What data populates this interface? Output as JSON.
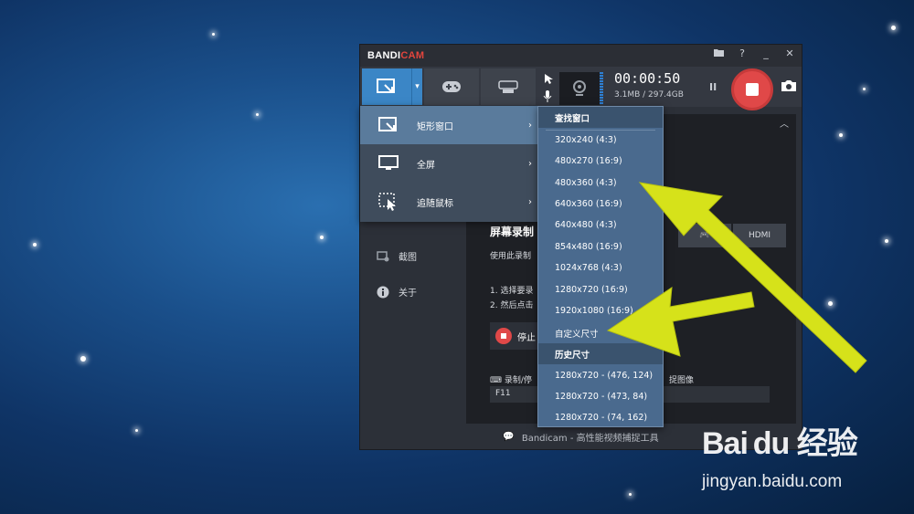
{
  "app": {
    "logo_main": "BANDI",
    "logo_accent": "CAM",
    "title_icons": [
      "folder-icon",
      "help-icon",
      "minimize-icon",
      "close-icon"
    ],
    "help_label": "?",
    "minimize_label": "_",
    "close_label": "✕"
  },
  "recording": {
    "timer": "00:00:50",
    "size": "3.1MB / 297.4GB",
    "pause_label": "II"
  },
  "mode_menu": {
    "items": [
      {
        "label": "矩形窗口",
        "icon": "rectangle-icon",
        "arrow": "›"
      },
      {
        "label": "全屏",
        "icon": "monitor-icon",
        "arrow": "›"
      },
      {
        "label": "追随鼠标",
        "icon": "cursor-select-icon",
        "arrow": "›"
      }
    ]
  },
  "size_menu": {
    "header1": "查找窗口",
    "sizes": [
      "320x240 (4:3)",
      "480x270 (16:9)",
      "480x360 (4:3)",
      "640x360 (16:9)",
      "640x480 (4:3)",
      "854x480 (16:9)",
      "1024x768 (4:3)",
      "1280x720 (16:9)",
      "1920x1080 (16:9)"
    ],
    "custom": "自定义尺寸",
    "header2": "历史尺寸",
    "history": [
      "1280x720 - (476, 124)",
      "1280x720 - (473, 84)",
      "1280x720 - (74, 162)"
    ]
  },
  "sidebar": {
    "items": [
      {
        "label": "截图",
        "icon": "screenshot-icon"
      },
      {
        "label": "关于",
        "icon": "info-icon"
      }
    ]
  },
  "content": {
    "title": "屏幕录制",
    "desc": "使用此录制",
    "step1": "1. 选择要录",
    "step2": "2. 然后点击",
    "stop_label": "停止",
    "hotkey_label": "录制/停",
    "capture_label": "捉图像",
    "hotkey_value": "F11",
    "hdmi_label": "HDMI"
  },
  "footer": {
    "text": "Bandicam - 高性能视频捕捉工具"
  },
  "watermark": {
    "logo": "Bai du 经验",
    "url": "jingyan.baidu.com"
  },
  "colors": {
    "accent_blue": "#3b86c6",
    "record_red": "#e04848",
    "arrow_yellow": "#d6e21a"
  }
}
